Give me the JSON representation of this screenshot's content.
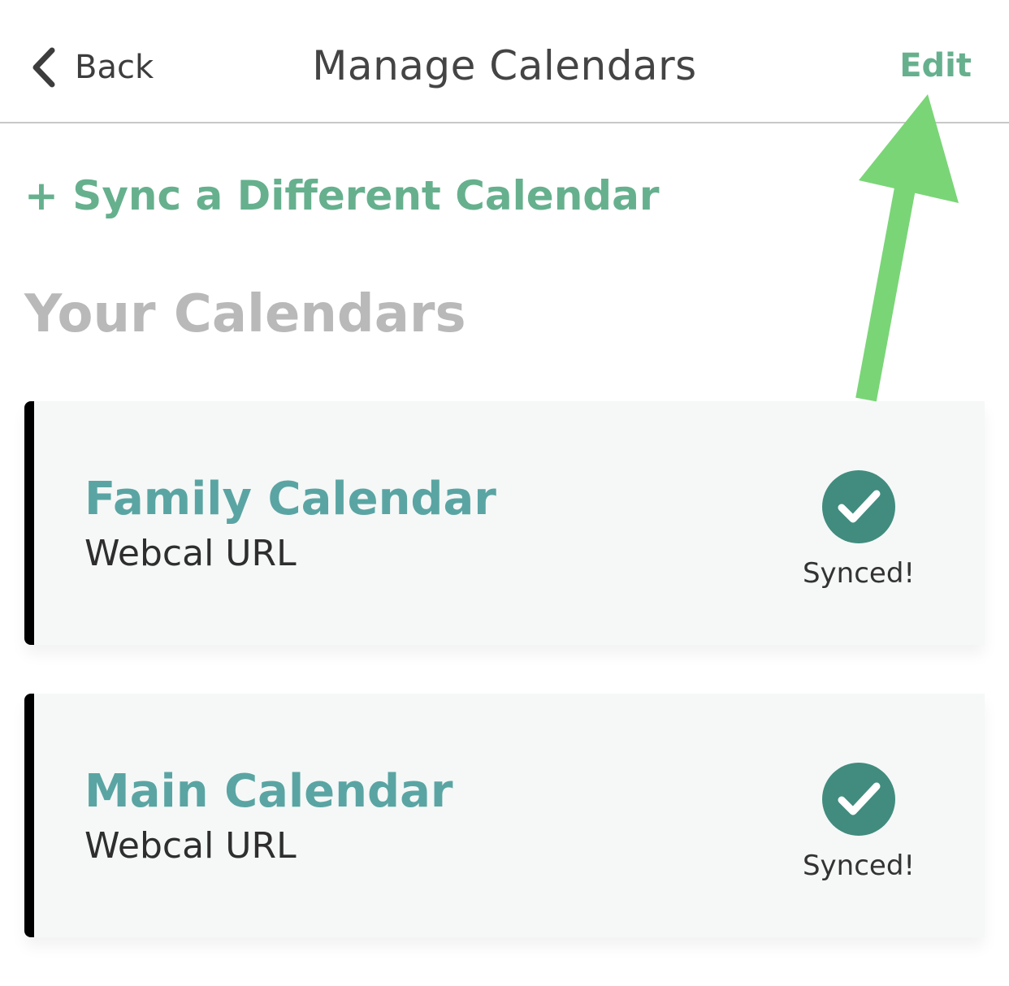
{
  "header": {
    "back_label": "Back",
    "title": "Manage Calendars",
    "edit_label": "Edit"
  },
  "actions": {
    "sync_label": "+ Sync a Different Calendar"
  },
  "section": {
    "heading": "Your Calendars"
  },
  "calendars": [
    {
      "name": "Family Calendar",
      "type": "Webcal URL",
      "status": "Synced!"
    },
    {
      "name": "Main Calendar",
      "type": "Webcal URL",
      "status": "Synced!"
    }
  ],
  "icons": {
    "back": "chevron-left-icon",
    "synced": "check-circle-icon",
    "annotation": "arrow-annotation"
  },
  "colors": {
    "accent": "#66b08e",
    "calendar_name": "#5aa5a3",
    "check_circle": "#418c7e",
    "annotation_arrow": "#7ad577",
    "card_background": "#f5f8f7"
  }
}
